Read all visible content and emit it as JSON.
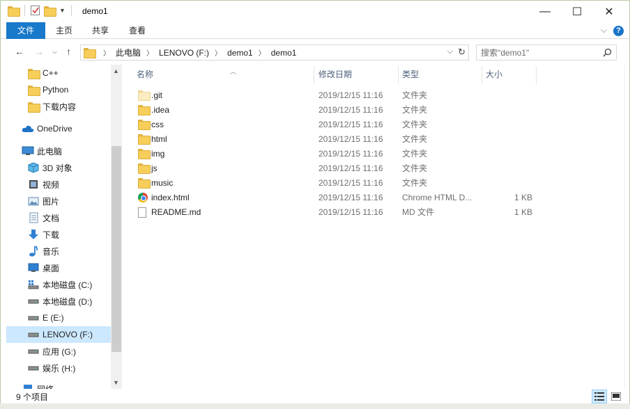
{
  "window": {
    "title": "demo1",
    "minimize_glyph": "—",
    "maximize_glyph": "☐",
    "close_glyph": "✕"
  },
  "ribbon": {
    "tabs": [
      "文件",
      "主页",
      "共享",
      "查看"
    ],
    "help_glyph": "?"
  },
  "address": {
    "crumbs": [
      "此电脑",
      "LENOVO (F:)",
      "demo1",
      "demo1"
    ],
    "search_placeholder": "搜索\"demo1\""
  },
  "nav": {
    "items": [
      {
        "label": "C++",
        "icon": "folder-icon"
      },
      {
        "label": "Python",
        "icon": "folder-icon"
      },
      {
        "label": "下载内容",
        "icon": "folder-icon"
      },
      {
        "label": "OneDrive",
        "icon": "onedrive-icon"
      },
      {
        "label": "此电脑",
        "icon": "computer-icon"
      },
      {
        "label": "3D 对象",
        "icon": "3d-objects-icon"
      },
      {
        "label": "视频",
        "icon": "video-icon"
      },
      {
        "label": "图片",
        "icon": "pictures-icon"
      },
      {
        "label": "文档",
        "icon": "documents-icon"
      },
      {
        "label": "下载",
        "icon": "download-icon"
      },
      {
        "label": "音乐",
        "icon": "music-icon"
      },
      {
        "label": "桌面",
        "icon": "desktop-icon"
      },
      {
        "label": "本地磁盘 (C:)",
        "icon": "system-drive-icon"
      },
      {
        "label": "本地磁盘 (D:)",
        "icon": "drive-icon"
      },
      {
        "label": "E (E:)",
        "icon": "drive-icon"
      },
      {
        "label": "LENOVO (F:)",
        "icon": "drive-icon",
        "selected": true
      },
      {
        "label": "应用 (G:)",
        "icon": "drive-icon"
      },
      {
        "label": "娱乐 (H:)",
        "icon": "drive-icon"
      },
      {
        "label": "网络",
        "icon": "network-icon"
      }
    ]
  },
  "columns": {
    "name": "名称",
    "modified": "修改日期",
    "type": "类型",
    "size": "大小"
  },
  "files": [
    {
      "name": ".git",
      "modified": "2019/12/15 11:16",
      "type": "文件夹",
      "size": "",
      "icon": "folder-hidden-icon"
    },
    {
      "name": ".idea",
      "modified": "2019/12/15 11:16",
      "type": "文件夹",
      "size": "",
      "icon": "folder-icon"
    },
    {
      "name": "css",
      "modified": "2019/12/15 11:16",
      "type": "文件夹",
      "size": "",
      "icon": "folder-icon"
    },
    {
      "name": "html",
      "modified": "2019/12/15 11:16",
      "type": "文件夹",
      "size": "",
      "icon": "folder-icon"
    },
    {
      "name": "img",
      "modified": "2019/12/15 11:16",
      "type": "文件夹",
      "size": "",
      "icon": "folder-icon"
    },
    {
      "name": "js",
      "modified": "2019/12/15 11:16",
      "type": "文件夹",
      "size": "",
      "icon": "folder-icon"
    },
    {
      "name": "music",
      "modified": "2019/12/15 11:16",
      "type": "文件夹",
      "size": "",
      "icon": "folder-icon"
    },
    {
      "name": "index.html",
      "modified": "2019/12/15 11:16",
      "type": "Chrome HTML D...",
      "size": "1 KB",
      "icon": "chrome-icon"
    },
    {
      "name": "README.md",
      "modified": "2019/12/15 11:16",
      "type": "MD 文件",
      "size": "1 KB",
      "icon": "file-icon"
    }
  ],
  "status": {
    "item_count": "9 个项目"
  },
  "colors": {
    "accent": "#1979ca",
    "selection": "#cce8ff",
    "header_text": "#4c607a"
  }
}
